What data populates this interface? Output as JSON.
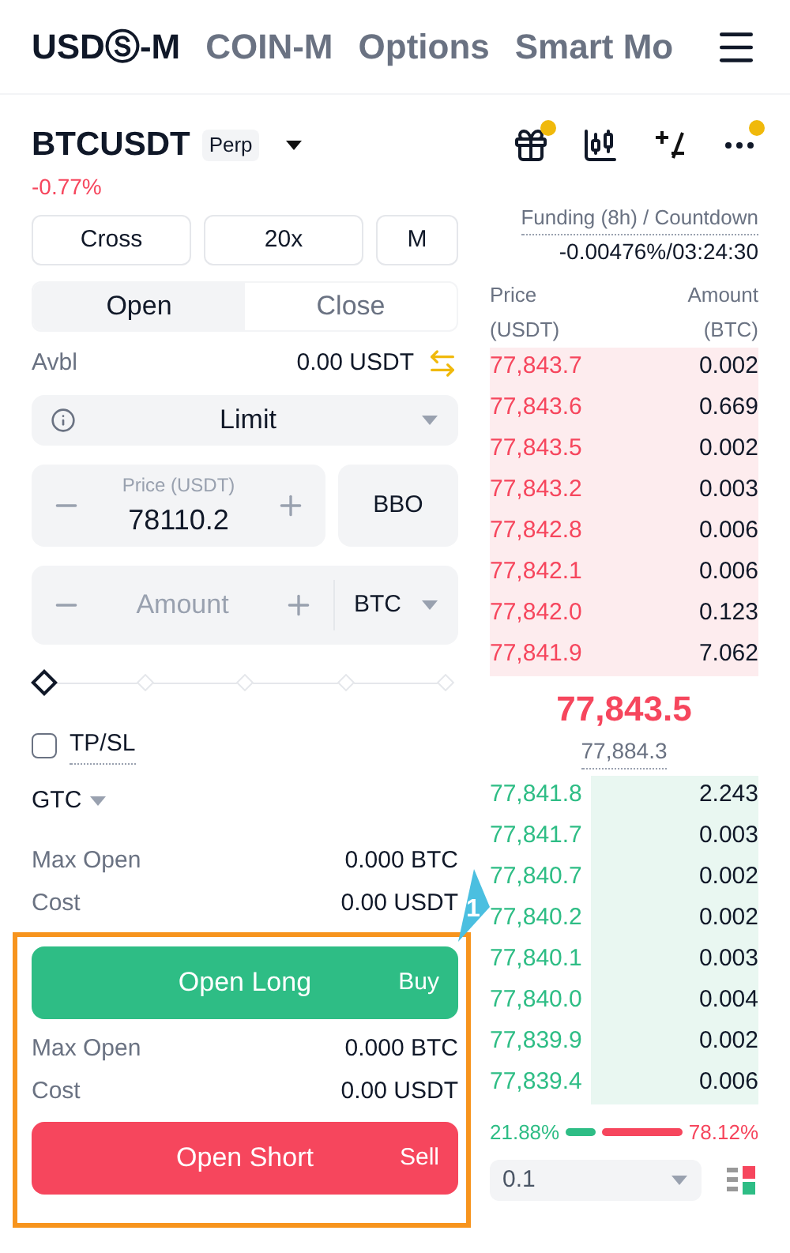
{
  "top_tabs": [
    {
      "label": "USDⓈ-M",
      "selected": true
    },
    {
      "label": "COIN-M",
      "selected": false
    },
    {
      "label": "Options",
      "selected": false
    },
    {
      "label": "Smart Mo",
      "selected": false
    }
  ],
  "symbol": {
    "name": "BTCUSDT",
    "badge": "Perp",
    "change": "-0.77%"
  },
  "settings": [
    "Cross",
    "20x",
    "M"
  ],
  "mode_tabs": [
    {
      "label": "Open",
      "selected": true
    },
    {
      "label": "Close",
      "selected": false
    }
  ],
  "available": {
    "label": "Avbl",
    "value": "0.00 USDT"
  },
  "order_type": "Limit",
  "price": {
    "label": "Price (USDT)",
    "value": "78110.2",
    "side_button": "BBO"
  },
  "amount": {
    "placeholder": "Amount",
    "unit": "BTC"
  },
  "slider": {
    "level": 0
  },
  "tpsl": {
    "label": "TP/SL",
    "checked": false
  },
  "tif": "GTC",
  "long_info": [
    {
      "label": "Max Open",
      "value": "0.000 BTC"
    },
    {
      "label": "Cost",
      "value": "0.00 USDT"
    }
  ],
  "long_button": {
    "label": "Open Long",
    "side": "Buy"
  },
  "short_info": [
    {
      "label": "Max Open",
      "value": "0.000 BTC"
    },
    {
      "label": "Cost",
      "value": "0.00 USDT"
    }
  ],
  "short_button": {
    "label": "Open Short",
    "side": "Sell"
  },
  "funding": {
    "label": "Funding (8h) / Countdown",
    "value": "-0.00476%/03:24:30"
  },
  "book_headers": [
    {
      "line1": "Price",
      "line2": "(USDT)"
    },
    {
      "line1": "Amount",
      "line2": "(BTC)"
    }
  ],
  "asks": [
    {
      "price": "77,843.7",
      "amount": "0.002"
    },
    {
      "price": "77,843.6",
      "amount": "0.669"
    },
    {
      "price": "77,843.5",
      "amount": "0.002"
    },
    {
      "price": "77,843.2",
      "amount": "0.003"
    },
    {
      "price": "77,842.8",
      "amount": "0.006"
    },
    {
      "price": "77,842.1",
      "amount": "0.006"
    },
    {
      "price": "77,842.0",
      "amount": "0.123"
    },
    {
      "price": "77,841.9",
      "amount": "7.062"
    }
  ],
  "last_price": "77,843.5",
  "mark_price": "77,884.3",
  "bids": [
    {
      "price": "77,841.8",
      "amount": "2.243"
    },
    {
      "price": "77,841.7",
      "amount": "0.003"
    },
    {
      "price": "77,840.7",
      "amount": "0.002"
    },
    {
      "price": "77,840.2",
      "amount": "0.002"
    },
    {
      "price": "77,840.1",
      "amount": "0.003"
    },
    {
      "price": "77,840.0",
      "amount": "0.004"
    },
    {
      "price": "77,839.9",
      "amount": "0.002"
    },
    {
      "price": "77,839.4",
      "amount": "0.006"
    }
  ],
  "ratio": {
    "buy": "21.88%",
    "sell": "78.12%"
  },
  "precision": "0.1",
  "annotation": {
    "label": "1"
  }
}
